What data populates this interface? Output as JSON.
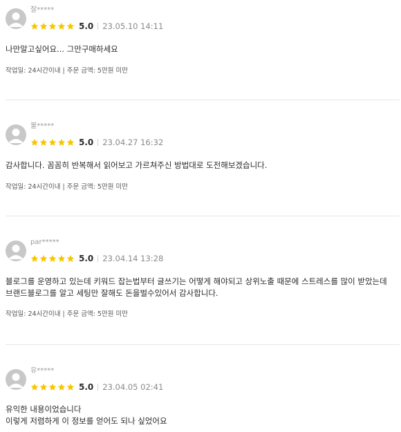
{
  "star_color": "#f7c600",
  "reviews": [
    {
      "username": "잘*****",
      "rating": 5,
      "score": "5.0",
      "date": "23.05.10 14:11",
      "content": "나만알고싶어요... 그만구매하세요",
      "order_info": "작업일: 24시간이내 | 주문 금액: 5만원 미만"
    },
    {
      "username": "불*****",
      "rating": 5,
      "score": "5.0",
      "date": "23.04.27 16:32",
      "content": "감사합니다. 꼼꼼히 반복해서 읽어보고 가르쳐주신 방법대로 도전해보겠습니다.",
      "order_info": "작업일: 24시간이내 | 주문 금액: 5만원 미만"
    },
    {
      "username": "par*****",
      "rating": 5,
      "score": "5.0",
      "date": "23.04.14 13:28",
      "content": "블로그를 운영하고 있는데 키워드 잡는법부터 글쓰기는 어떻게 해야되고 상위노출 때문에 스트레스를 많이 받았는데\n브랜드블로그를 알고 세팅만 잘해도 돈을벌수있어서 감사합니다.",
      "order_info": "작업일: 24시간이내 | 주문 금액: 5만원 미만"
    },
    {
      "username": "유*****",
      "rating": 5,
      "score": "5.0",
      "date": "23.04.05 02:41",
      "content": "유익한 내용이었습니다\n이렇게 저렴하게 이 정보를 얻어도 되나 싶었어요",
      "order_info": ""
    }
  ]
}
